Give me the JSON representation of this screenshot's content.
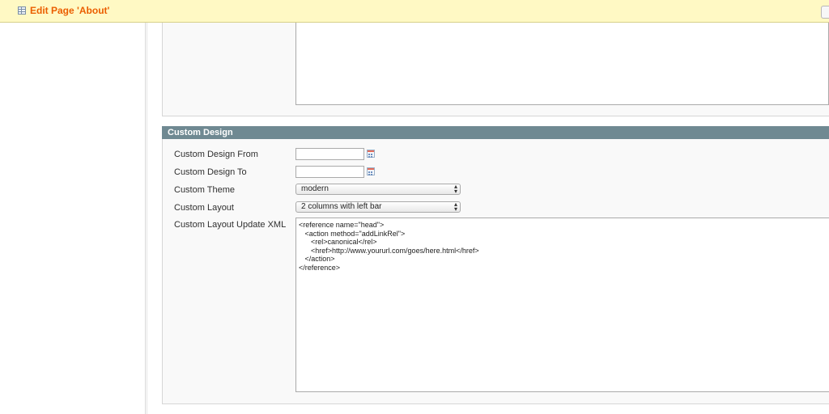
{
  "header": {
    "title": "Edit Page 'About'",
    "page_icon": "grid-icon",
    "title_color": "#eb5e00",
    "background": "#fff9c4"
  },
  "custom_design": {
    "section_title": "Custom Design",
    "header_color": "#6f8992",
    "fields": {
      "design_from": {
        "label": "Custom Design From",
        "value": ""
      },
      "design_to": {
        "label": "Custom Design To",
        "value": ""
      },
      "theme": {
        "label": "Custom Theme",
        "value": "modern"
      },
      "layout": {
        "label": "Custom Layout",
        "value": "2 columns with left bar"
      },
      "layout_xml": {
        "label": "Custom Layout Update XML",
        "lines": [
          "<reference name=\"head\">",
          "   <action method=\"addLinkRel\">",
          "      <rel>canonical</rel>",
          "      <href>http://www.yoururl.com/goes/here.html</href>",
          "   </action>",
          "</reference>"
        ]
      }
    }
  }
}
